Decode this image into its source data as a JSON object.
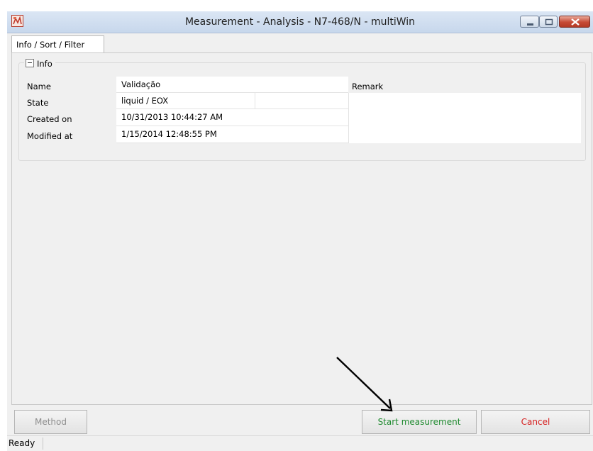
{
  "window": {
    "title": "Measurement - Analysis - N7-468/N - multiWin",
    "app_icon": "multiwin-app-icon",
    "controls": [
      "minimize-icon",
      "maximize-icon",
      "close-icon"
    ]
  },
  "tabs": [
    {
      "label": "Info / Sort / Filter",
      "active": true
    }
  ],
  "info_group": {
    "header": "Info",
    "fields": {
      "name_label": "Name",
      "name_value": "Validação",
      "state_label": "State",
      "state_value": "liquid / EOX",
      "created_label": "Created on",
      "created_value": "10/31/2013 10:44:27 AM",
      "modified_label": "Modified at",
      "modified_value": "1/15/2014 12:48:55 PM",
      "remark_label": "Remark",
      "remark_value": ""
    }
  },
  "buttons": {
    "method": "Method",
    "start": "Start measurement",
    "cancel": "Cancel"
  },
  "status": {
    "text": "Ready"
  },
  "colors": {
    "start_text": "#1f8a2f",
    "cancel_text": "#d62020",
    "disabled_text": "#8d8d8d"
  }
}
